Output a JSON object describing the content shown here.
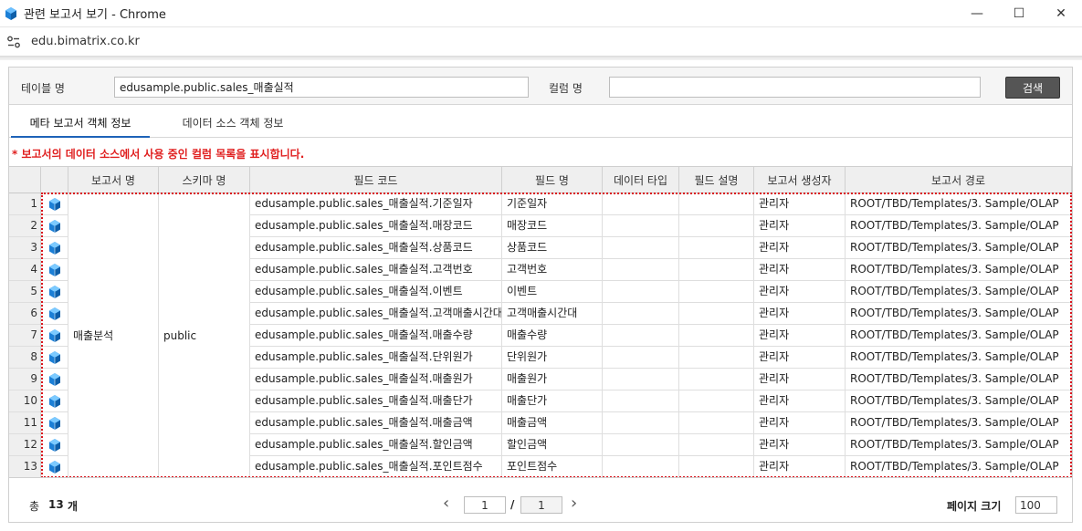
{
  "window": {
    "title": "관련 보고서 보기 - Chrome",
    "url": "edu.bimatrix.co.kr",
    "minimize": "—",
    "maximize": "☐",
    "close": "✕"
  },
  "search": {
    "table_label": "테이블 명",
    "table_value": "edusample.public.sales_매출실적",
    "column_label": "컬럼 명",
    "column_value": "",
    "button": "검색"
  },
  "tabs": [
    {
      "label": "메타 보고서 객체 정보",
      "active": true
    },
    {
      "label": "데이터 소스 객체 정보",
      "active": false
    }
  ],
  "notice": "* 보고서의 데이터 소스에서 사용 중인 컬럼 목록을 표시합니다.",
  "grid": {
    "headers": [
      "보고서 명",
      "스키마 명",
      "필드 코드",
      "필드 명",
      "데이터 타입",
      "필드 설명",
      "보고서 생성자",
      "보고서 경로"
    ],
    "report_name": "매출분석",
    "schema_name": "public",
    "rows": [
      {
        "no": "1",
        "code": "edusample.public.sales_매출실적.기준일자",
        "name": "기준일자",
        "type": "",
        "desc": "",
        "creator": "관리자",
        "path": "ROOT/TBD/Templates/3. Sample/OLAP"
      },
      {
        "no": "2",
        "code": "edusample.public.sales_매출실적.매장코드",
        "name": "매장코드",
        "type": "",
        "desc": "",
        "creator": "관리자",
        "path": "ROOT/TBD/Templates/3. Sample/OLAP"
      },
      {
        "no": "3",
        "code": "edusample.public.sales_매출실적.상품코드",
        "name": "상품코드",
        "type": "",
        "desc": "",
        "creator": "관리자",
        "path": "ROOT/TBD/Templates/3. Sample/OLAP"
      },
      {
        "no": "4",
        "code": "edusample.public.sales_매출실적.고객번호",
        "name": "고객번호",
        "type": "",
        "desc": "",
        "creator": "관리자",
        "path": "ROOT/TBD/Templates/3. Sample/OLAP"
      },
      {
        "no": "5",
        "code": "edusample.public.sales_매출실적.이벤트",
        "name": "이벤트",
        "type": "",
        "desc": "",
        "creator": "관리자",
        "path": "ROOT/TBD/Templates/3. Sample/OLAP"
      },
      {
        "no": "6",
        "code": "edusample.public.sales_매출실적.고객매출시간대",
        "name": "고객매출시간대",
        "type": "",
        "desc": "",
        "creator": "관리자",
        "path": "ROOT/TBD/Templates/3. Sample/OLAP"
      },
      {
        "no": "7",
        "code": "edusample.public.sales_매출실적.매출수량",
        "name": "매출수량",
        "type": "",
        "desc": "",
        "creator": "관리자",
        "path": "ROOT/TBD/Templates/3. Sample/OLAP"
      },
      {
        "no": "8",
        "code": "edusample.public.sales_매출실적.단위원가",
        "name": "단위원가",
        "type": "",
        "desc": "",
        "creator": "관리자",
        "path": "ROOT/TBD/Templates/3. Sample/OLAP"
      },
      {
        "no": "9",
        "code": "edusample.public.sales_매출실적.매출원가",
        "name": "매출원가",
        "type": "",
        "desc": "",
        "creator": "관리자",
        "path": "ROOT/TBD/Templates/3. Sample/OLAP"
      },
      {
        "no": "10",
        "code": "edusample.public.sales_매출실적.매출단가",
        "name": "매출단가",
        "type": "",
        "desc": "",
        "creator": "관리자",
        "path": "ROOT/TBD/Templates/3. Sample/OLAP"
      },
      {
        "no": "11",
        "code": "edusample.public.sales_매출실적.매출금액",
        "name": "매출금액",
        "type": "",
        "desc": "",
        "creator": "관리자",
        "path": "ROOT/TBD/Templates/3. Sample/OLAP"
      },
      {
        "no": "12",
        "code": "edusample.public.sales_매출실적.할인금액",
        "name": "할인금액",
        "type": "",
        "desc": "",
        "creator": "관리자",
        "path": "ROOT/TBD/Templates/3. Sample/OLAP"
      },
      {
        "no": "13",
        "code": "edusample.public.sales_매출실적.포인트점수",
        "name": "포인트점수",
        "type": "",
        "desc": "",
        "creator": "관리자",
        "path": "ROOT/TBD/Templates/3. Sample/OLAP"
      }
    ]
  },
  "footer": {
    "total_prefix": "총",
    "total_count": "13",
    "total_suffix": "개",
    "prev": "‹",
    "next": "›",
    "current_page": "1",
    "separator": "/",
    "total_pages": "1",
    "page_size_label": "페이지 크기",
    "page_size": "100"
  },
  "colors": {
    "accent_tab": "#1e63b8",
    "notice": "#e02020",
    "selection": "#d9141c",
    "icon": "#1b7fd6"
  },
  "icons": {
    "app": "bimatrix-cube-icon",
    "site": "site-settings-icon",
    "row": "report-cube-icon"
  }
}
